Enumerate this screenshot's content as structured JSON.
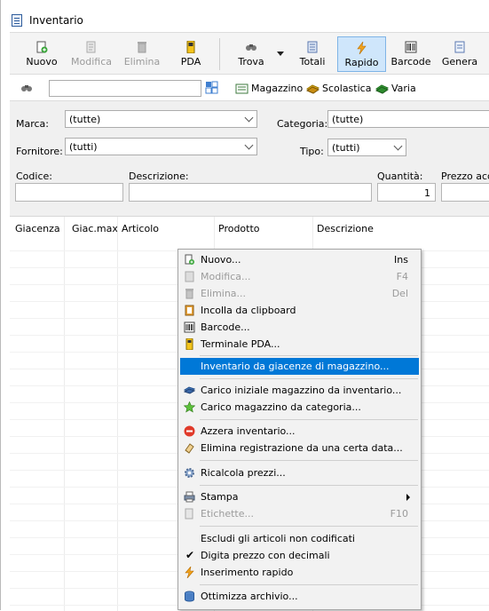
{
  "window": {
    "title": "Inventario"
  },
  "toolbar": {
    "nuovo": "Nuovo",
    "modifica": "Modifica",
    "elimina": "Elimina",
    "pda": "PDA",
    "trova": "Trova",
    "totali": "Totali",
    "rapido": "Rapido",
    "barcode": "Barcode",
    "genera": "Genera"
  },
  "filters": {
    "magazzino": "Magazzino",
    "scolastica": "Scolastica",
    "varia": "Varia"
  },
  "form": {
    "marca_label": "Marca:",
    "marca_value": "(tutte)",
    "categoria_label": "Categoria:",
    "categoria_value": "(tutte)",
    "fornitore_label": "Fornitore:",
    "fornitore_value": "(tutti)",
    "tipo_label": "Tipo:",
    "tipo_value": "(tutti)",
    "codice_label": "Codice:",
    "descrizione_label": "Descrizione:",
    "quantita_label": "Quantità:",
    "quantita_value": "1",
    "prezzo_label": "Prezzo acqu"
  },
  "grid": {
    "columns": [
      "Giacenza",
      "Giac.max",
      "Articolo",
      "Prodotto",
      "Descrizione"
    ]
  },
  "menu": {
    "nuovo": "Nuovo...",
    "nuovo_sc": "Ins",
    "modifica": "Modifica...",
    "modifica_sc": "F4",
    "elimina": "Elimina...",
    "elimina_sc": "Del",
    "incolla": "Incolla da clipboard",
    "barcode": "Barcode...",
    "terminale": "Terminale PDA...",
    "inventario": "Inventario da giacenze di magazzino...",
    "carico_iniziale": "Carico iniziale magazzino da inventario...",
    "carico_categoria": "Carico magazzino da categoria...",
    "azzera": "Azzera inventario...",
    "elimina_reg": "Elimina registrazione da una certa data...",
    "ricalcola": "Ricalcola prezzi...",
    "stampa": "Stampa",
    "etichette": "Etichette...",
    "etichette_sc": "F10",
    "escludi": "Escludi gli articoli non codificati",
    "digita": "Digita prezzo con decimali",
    "inserimento": "Inserimento rapido",
    "ottimizza": "Ottimizza archivio..."
  }
}
